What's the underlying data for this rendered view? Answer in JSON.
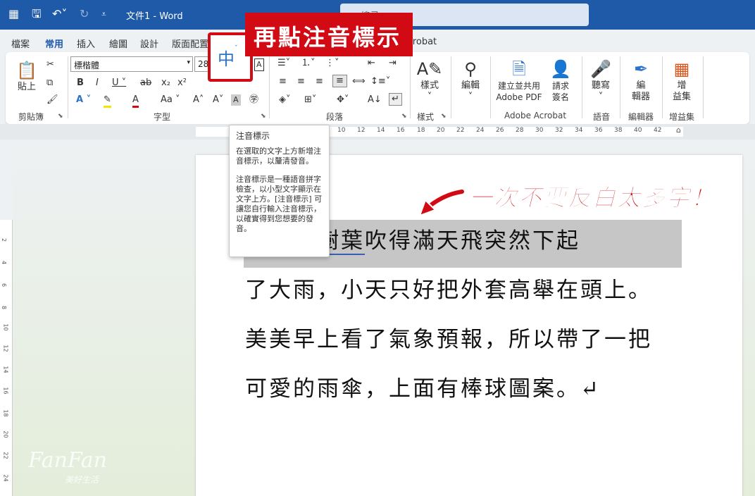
{
  "titlebar": {
    "doc_title": "文件1 - Word",
    "search_placeholder": "搜尋"
  },
  "menu": [
    "檔案",
    "常用",
    "插入",
    "繪圖",
    "設計",
    "版面配置",
    "Acrobat"
  ],
  "ribbon": {
    "clipboard": {
      "paste": "貼上",
      "label": "剪貼簿"
    },
    "font": {
      "name": "標楷體",
      "size": "28",
      "label": "字型"
    },
    "paragraph": {
      "label": "段落"
    },
    "styles": {
      "button": "樣式",
      "label": "樣式"
    },
    "editing": {
      "button": "編輯"
    },
    "acrobat": {
      "create_pdf_1": "建立並共用",
      "create_pdf_2": "Adobe PDF",
      "sign_1": "請求",
      "sign_2": "簽名",
      "label": "Adobe Acrobat"
    },
    "voice": {
      "button": "聽寫",
      "label": "語音"
    },
    "editor": {
      "button_1": "編",
      "button_2": "輯器",
      "label": "編輯器"
    },
    "addins": {
      "button_1": "增",
      "button_2": "益集",
      "label": "增益集"
    }
  },
  "ruler_ticks": [
    "10",
    "12",
    "14",
    "16",
    "18",
    "20",
    "22",
    "24",
    "26",
    "28",
    "30",
    "32",
    "34",
    "36",
    "38",
    "40",
    "42"
  ],
  "ruler_v_ticks": [
    "2",
    "4",
    "6",
    "8",
    "10",
    "12",
    "14",
    "16",
    "18",
    "20",
    "22",
    "24"
  ],
  "tooltip": {
    "title": "注音標示",
    "p1": "在選取的文字上方新增注音標示，以釐清發音。",
    "p2": "注音標示是一種語音拼字檢查，以小型文字顯示在文字上方。[注音標示] 可讓您自行輸入注音標示，以確實得到您想要的發音。"
  },
  "document": {
    "line1_pre": "，",
    "line1_underlined": "風把樹葉",
    "line1_post": "吹得滿天飛突然下起",
    "line2": "了大雨，小天只好把外套高舉在頭上。",
    "line3": "美美早上看了氣象預報，所以帶了一把",
    "line4": "可愛的雨傘，上面有棒球圖案。↵"
  },
  "annotations": {
    "callout_top": "再點注音標示",
    "callout_right": "一次不要反白太多字！"
  },
  "watermark": {
    "main": "FanFan",
    "sub": "美好生活"
  },
  "colors": {
    "word_blue": "#1e5aa7",
    "annotation_red": "#d10a14",
    "selection_gray": "#c6c6c6"
  }
}
